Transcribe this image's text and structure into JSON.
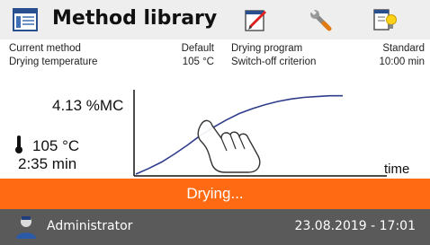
{
  "header": {
    "title": "Method library",
    "icons": [
      "library-icon",
      "edit-method-icon",
      "settings-wrench-icon",
      "thermometer-lamp-icon"
    ]
  },
  "info": {
    "current_method_label": "Current method",
    "current_method_value": "Default",
    "drying_program_label": "Drying program",
    "drying_program_value": "Standard",
    "drying_temperature_label": "Drying temperature",
    "drying_temperature_value": "105 °C",
    "switch_off_label": "Switch-off criterion",
    "switch_off_value": "10:00 min"
  },
  "readout": {
    "moisture": "4.13 %MC",
    "temperature": "105 °C",
    "elapsed": "2:35 min",
    "x_axis_label": "time"
  },
  "chart_data": {
    "type": "line",
    "title": "",
    "xlabel": "time",
    "ylabel": "",
    "series": [
      {
        "values": [
          0,
          0.07,
          0.15,
          0.25,
          0.36,
          0.48,
          0.58,
          0.67,
          0.75,
          0.81,
          0.86,
          0.9,
          0.93,
          0.95,
          0.96,
          0.97,
          0.97
        ]
      }
    ]
  },
  "status": {
    "text": "Drying..."
  },
  "footer": {
    "user": "Administrator",
    "datetime": "23.08.2019 - 17:01"
  },
  "colors": {
    "status_bar": "#ff6a13",
    "footer": "#5a5a5a",
    "curve": "#2f3c8c"
  }
}
